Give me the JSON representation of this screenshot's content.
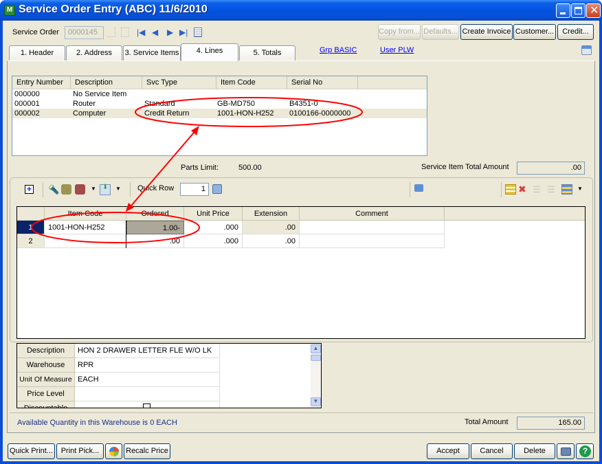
{
  "window": {
    "title": "Service Order Entry (ABC) 11/6/2010",
    "app_icon": "mas90-app-icon",
    "controls": [
      "minimize-icon",
      "maximize-icon",
      "close-icon"
    ]
  },
  "header": {
    "service_order_label": "Service Order",
    "service_order_value": "0000145",
    "nav_icons": [
      "new-record-icon",
      "delete-record-icon",
      "first-record-icon",
      "previous-record-icon",
      "next-record-icon",
      "last-record-icon",
      "lookup-list-icon"
    ],
    "buttons": {
      "copy_from": "Copy from...",
      "defaults": "Defaults...",
      "create_invoice": "Create Invoice",
      "customer": "Customer...",
      "credit": "Credit..."
    }
  },
  "tabs": [
    {
      "label": "1. Header",
      "active": false
    },
    {
      "label": "2. Address",
      "active": false
    },
    {
      "label": "3. Service Items",
      "active": false
    },
    {
      "label": "4. Lines",
      "active": true
    },
    {
      "label": "5. Totals",
      "active": false
    }
  ],
  "links": {
    "group": "Grp BASIC",
    "user": "User PLW"
  },
  "service_items": {
    "columns": [
      "Entry Number",
      "Description",
      "Svc Type",
      "Item Code",
      "Serial No"
    ],
    "rows": [
      {
        "entry": "000000",
        "description": "No Service Item",
        "svc_type": "",
        "item_code": "",
        "serial": ""
      },
      {
        "entry": "000001",
        "description": "Router",
        "svc_type": "Standard",
        "item_code": "GB-MD750",
        "serial": "B4351-0"
      },
      {
        "entry": "000002",
        "description": "Computer",
        "svc_type": "Credit Return",
        "item_code": "1001-HON-H252",
        "serial": "0100166-0000000",
        "selected": true
      }
    ]
  },
  "parts_limit": {
    "label": "Parts Limit:",
    "value": "500.00"
  },
  "service_item_total": {
    "label": "Service Item Total Amount",
    "value": ".00"
  },
  "toolbar": {
    "quick_row_label": "Quick Row",
    "quick_row_value": "1",
    "left_icons": [
      "expand-icon",
      "flashlight-icon",
      "binoculars-icon",
      "binoculars-red-icon",
      "dropdown-arrow-icon",
      "import-icon",
      "dropdown-arrow-icon"
    ],
    "right_icons": [
      "comment-icon",
      "insert-line-icon",
      "delete-line-icon",
      "indent-icon",
      "outdent-icon",
      "renumber-icon",
      "dropdown-arrow-icon"
    ]
  },
  "lines_grid": {
    "columns": [
      "",
      "Item Code",
      "Ordered",
      "Unit Price",
      "Extension",
      "Comment"
    ],
    "rows": [
      {
        "num": "1",
        "item_code": "1001-HON-H252",
        "ordered": "1.00-",
        "unit_price": ".000",
        "extension": ".00",
        "comment": "",
        "selected": true
      },
      {
        "num": "2",
        "item_code": "",
        "ordered": ".00",
        "unit_price": ".000",
        "extension": ".00",
        "comment": ""
      }
    ]
  },
  "properties": [
    {
      "label": "Description",
      "value": "HON 2 DRAWER LETTER FLE W/O LK"
    },
    {
      "label": "Warehouse",
      "value": "RPR"
    },
    {
      "label": "Unit Of Measure",
      "value": "EACH"
    },
    {
      "label": "Price Level",
      "value": ""
    },
    {
      "label": "Discountable",
      "value": ""
    }
  ],
  "status": {
    "available_qty": "Available Quantity in this Warehouse is 0 EACH"
  },
  "total_amount": {
    "label": "Total Amount",
    "value": "165.00"
  },
  "footer": {
    "quick_print": "Quick Print...",
    "print_pick": "Print Pick...",
    "recalc_price": "Recalc Price",
    "accept": "Accept",
    "cancel": "Cancel",
    "delete": "Delete"
  },
  "annotation": {
    "color": "#ff0000",
    "description": "red ellipses linking service item 1001-HON-H252 to line item"
  }
}
